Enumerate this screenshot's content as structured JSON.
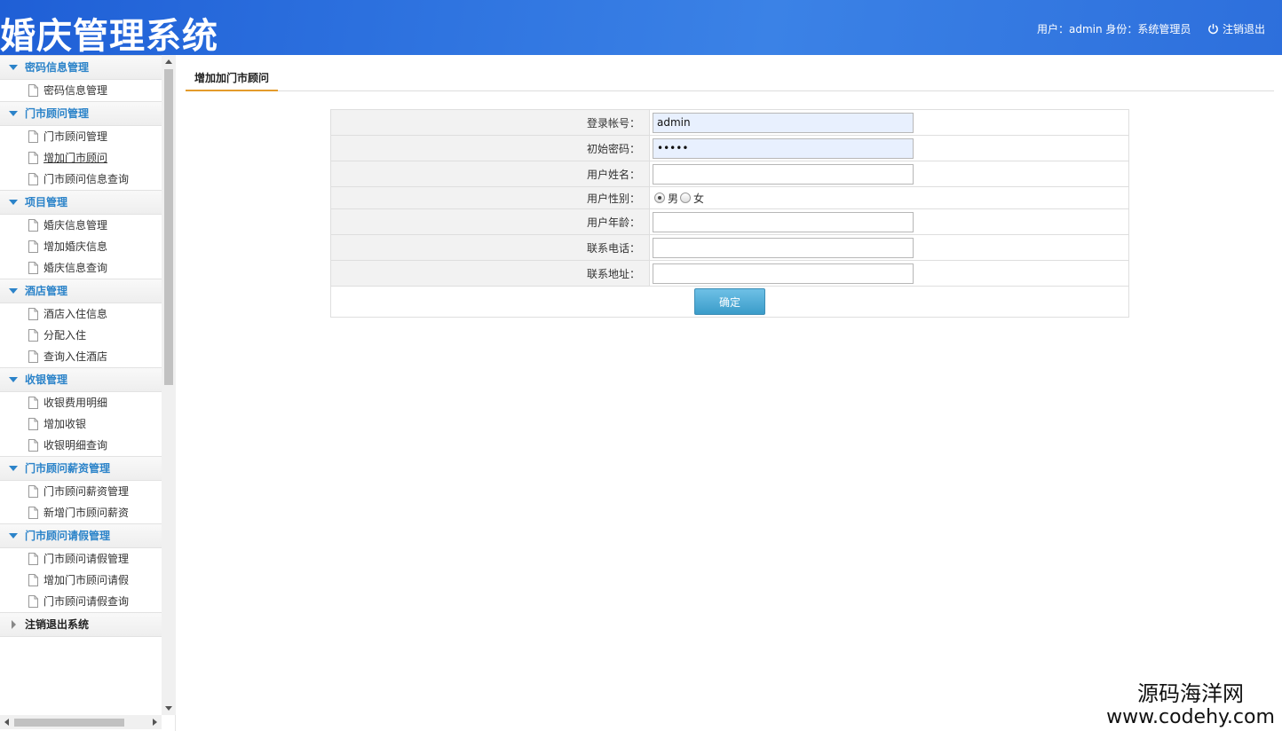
{
  "header": {
    "title": "婚庆管理系统",
    "user_info": "用户：admin 身份：系统管理员",
    "logout_label": "注销退出"
  },
  "sidebar": {
    "groups": [
      {
        "title": "密码信息管理",
        "items": [
          "密码信息管理"
        ]
      },
      {
        "title": "门市顾问管理",
        "items": [
          "门市顾问管理",
          "增加门市顾问",
          "门市顾问信息查询"
        ]
      },
      {
        "title": "项目管理",
        "items": [
          "婚庆信息管理",
          "增加婚庆信息",
          "婚庆信息查询"
        ]
      },
      {
        "title": "酒店管理",
        "items": [
          "酒店入住信息",
          "分配入住",
          "查询入住酒店"
        ]
      },
      {
        "title": "收银管理",
        "items": [
          "收银费用明细",
          "增加收银",
          "收银明细查询"
        ]
      },
      {
        "title": "门市顾问薪资管理",
        "items": [
          "门市顾问薪资管理",
          "新增门市顾问薪资"
        ]
      },
      {
        "title": "门市顾问请假管理",
        "items": [
          "门市顾问请假管理",
          "增加门市顾问请假",
          "门市顾问请假查询"
        ]
      }
    ],
    "logout_group": "注销退出系统"
  },
  "main": {
    "tab_label": "增加加门市顾问",
    "form": {
      "login_label": "登录帐号：",
      "login_value": "admin",
      "password_label": "初始密码：",
      "password_value": "admin",
      "name_label": "用户姓名：",
      "gender_label": "用户性别：",
      "gender_male": "男",
      "gender_female": "女",
      "age_label": "用户年龄：",
      "phone_label": "联系电话：",
      "address_label": "联系地址：",
      "submit_label": "确定"
    }
  },
  "watermark": {
    "line1": "源码海洋网",
    "line2": "www.codehy.com"
  }
}
